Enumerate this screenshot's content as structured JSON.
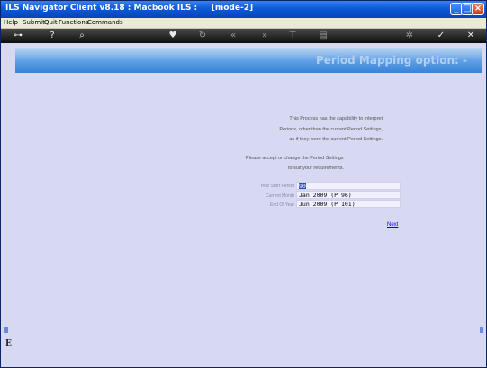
{
  "window": {
    "title": "ILS Navigator Client v8.18 : Macbook ILS :     [mode-2]"
  },
  "menu": [
    "Help",
    "Submit",
    "Quit",
    "Functions",
    "Commands"
  ],
  "toolbar_icons": [
    "key-icon",
    "help-icon",
    "search-icon",
    "heart-icon",
    "refresh-icon",
    "rewind-icon",
    "fast-forward-icon",
    "pin-icon",
    "document-icon",
    "settings-icon",
    "check-icon",
    "close-icon"
  ],
  "banner": {
    "title": "Period Mapping option: -"
  },
  "intro": {
    "lines": [
      "This Process has the capability to interpret",
      "Periods, other than the current Period Settings,",
      "as if they were the current Period Settings."
    ]
  },
  "instructions": {
    "lines": [
      "Please accept or change the Period Settings",
      "to suit your requirements."
    ]
  },
  "fields": [
    {
      "label": "Year Start Period",
      "value": "90",
      "selected": true
    },
    {
      "label": "Current Month",
      "value": "Jan 2009 (P 96)",
      "selected": false
    },
    {
      "label": "End Of Year",
      "value": "Jun 2009 (P 101)",
      "selected": false
    }
  ],
  "next_label": "Next",
  "side_letter": "E",
  "colors": {
    "background": "#d7d8f1",
    "titlebar": "#0a5ad8",
    "banner": "#5b9ee4",
    "link": "#0000e0"
  }
}
